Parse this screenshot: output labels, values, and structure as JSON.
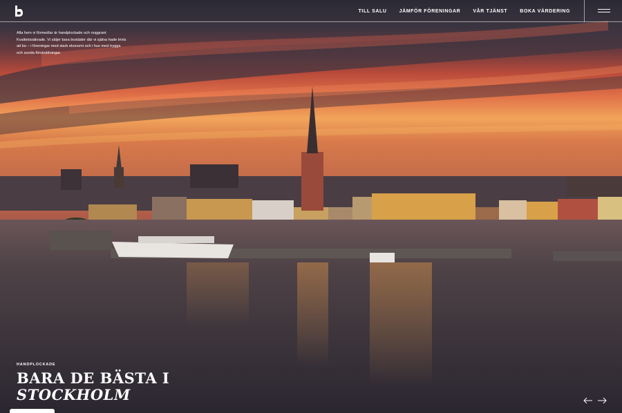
{
  "header": {
    "logo_icon": "b-logo-icon",
    "nav": [
      {
        "label": "TILL SALU"
      },
      {
        "label": "JÄMFÖR FÖRENINGAR"
      },
      {
        "label": "VÅR TJÄNST"
      },
      {
        "label": "BOKA VÄRDERING"
      }
    ],
    "menu_icon": "hamburger-icon"
  },
  "intro": {
    "text": "Alla hem vi förmedlar är handplockade och noggrant Kvalitetssäkrade. Vi säljer bara bostäder där vi själva hade trivts att bo – i föreningar med stark ekonomi och i hus med trygga och sunda förutsättningar."
  },
  "hero": {
    "eyebrow": "HANDPLOCKADE",
    "title_line1": "BARA DE BÄSTA I",
    "title_line2": "STOCKHOLM",
    "prev_icon": "arrow-left-icon",
    "next_icon": "arrow-right-icon"
  },
  "colors": {
    "sky_top": "#2e2a35",
    "sunset_red": "#d9503a",
    "sunset_orange": "#f0a050",
    "water": "#3a3238",
    "text": "#ffffff"
  }
}
